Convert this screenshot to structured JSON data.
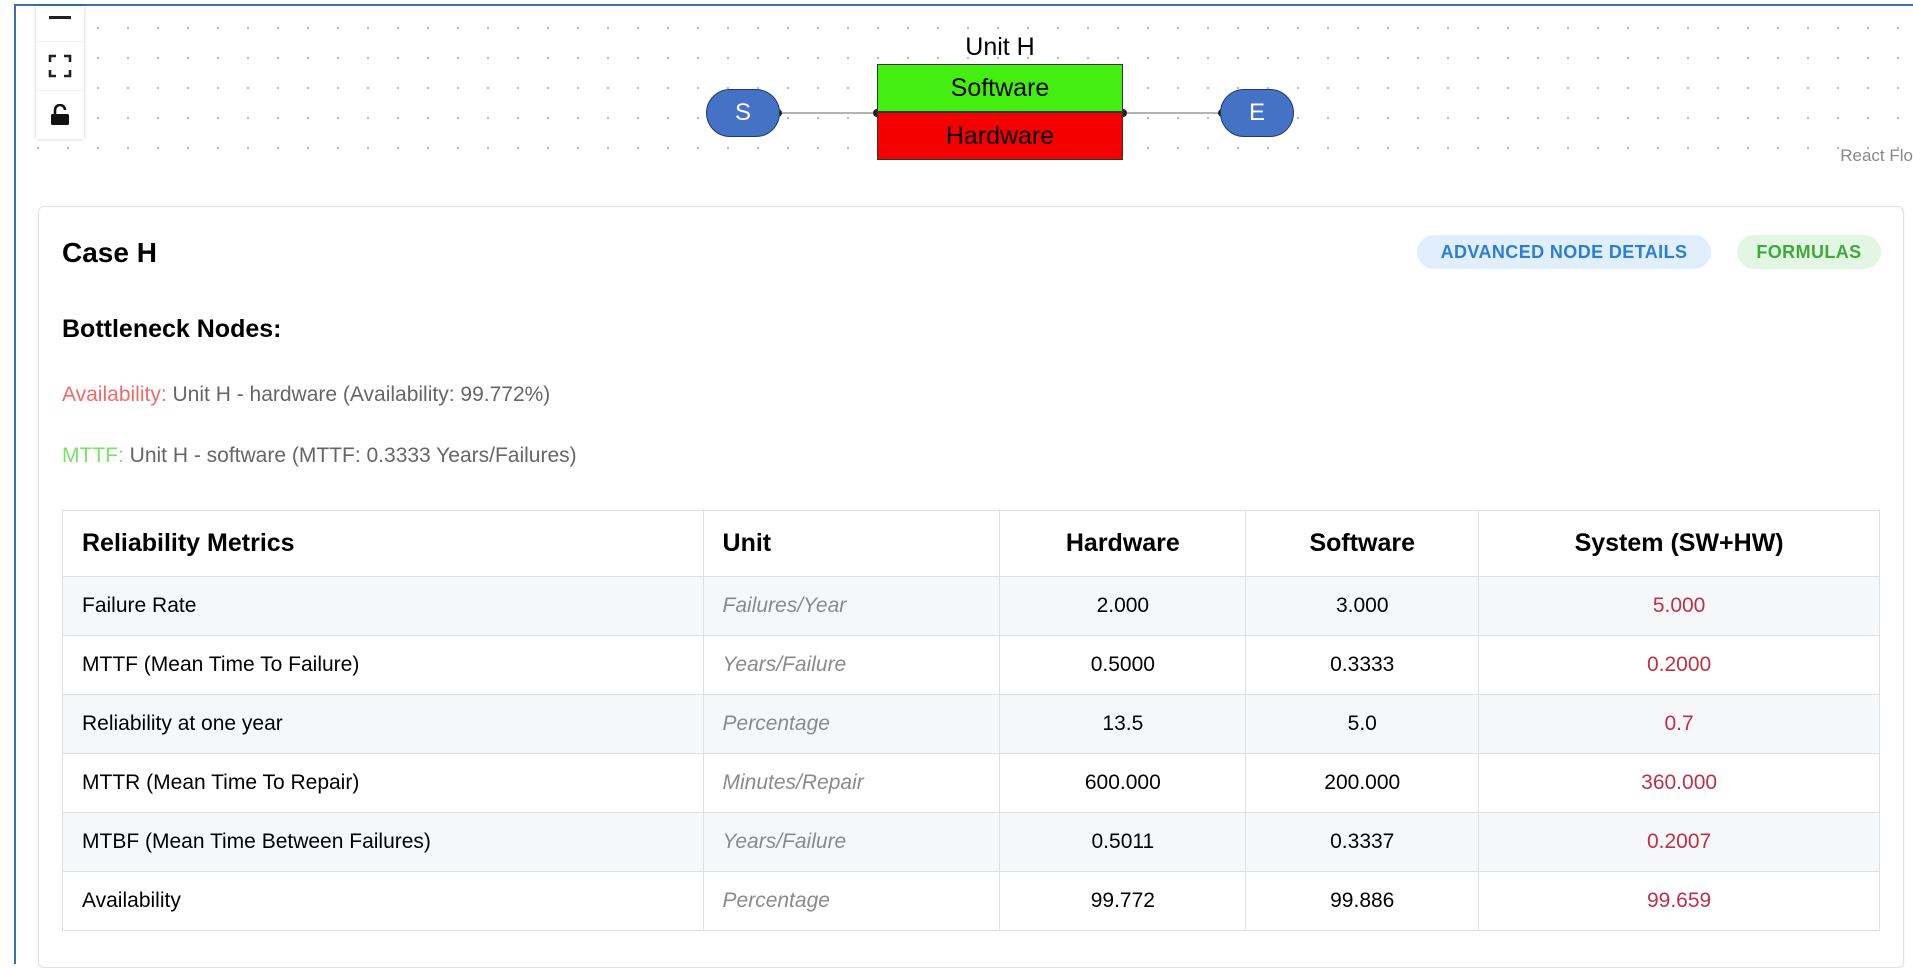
{
  "flow": {
    "controls": {
      "zoom_out_icon": "minus-icon",
      "fit_view_icon": "fit-view-icon",
      "lock_icon": "unlock-icon"
    },
    "node_group_title": "Unit H",
    "software_label": "Software",
    "hardware_label": "Hardware",
    "start_label": "S",
    "end_label": "E",
    "attribution": "React Flo",
    "colors": {
      "software": "#44ee11",
      "hardware": "#f40000",
      "terminal": "#4472c4"
    }
  },
  "panel": {
    "title": "Case H",
    "advanced_button": "ADVANCED NODE DETAILS",
    "formulas_button": "FORMULAS",
    "bottleneck_title": "Bottleneck Nodes:",
    "availability_key": "Availability:",
    "availability_value": "Unit H - hardware (Availability: 99.772%)",
    "mttf_key": "MTTF:",
    "mttf_value": "Unit H - software (MTTF: 0.3333 Years/Failures)"
  },
  "table": {
    "headers": [
      "Reliability Metrics",
      "Unit",
      "Hardware",
      "Software",
      "System (SW+HW)"
    ],
    "rows": [
      {
        "metric": "Failure Rate",
        "unit": "Failures/Year",
        "hardware": "2.000",
        "software": "3.000",
        "system": "5.000"
      },
      {
        "metric": "MTTF (Mean Time To Failure)",
        "unit": "Years/Failure",
        "hardware": "0.5000",
        "software": "0.3333",
        "system": "0.2000"
      },
      {
        "metric": "Reliability at one year",
        "unit": "Percentage",
        "hardware": "13.5",
        "software": "5.0",
        "system": "0.7"
      },
      {
        "metric": "MTTR (Mean Time To Repair)",
        "unit": "Minutes/Repair",
        "hardware": "600.000",
        "software": "200.000",
        "system": "360.000"
      },
      {
        "metric": "MTBF (Mean Time Between Failures)",
        "unit": "Years/Failure",
        "hardware": "0.5011",
        "software": "0.3337",
        "system": "0.2007"
      },
      {
        "metric": "Availability",
        "unit": "Percentage",
        "hardware": "99.772",
        "software": "99.886",
        "system": "99.659"
      }
    ]
  }
}
